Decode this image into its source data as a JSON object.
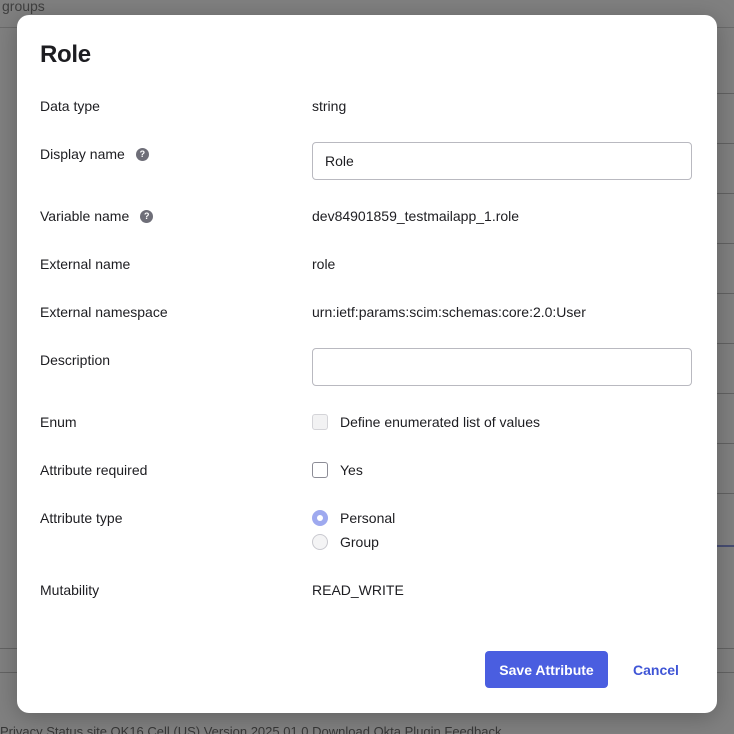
{
  "background": {
    "top_text": "groups",
    "footer_text": "Privacy   Status site   OK16 Cell (US)   Version 2025.01.0   Download Okta Plugin   Feedback"
  },
  "modal": {
    "title": "Role",
    "fields": {
      "data_type": {
        "label": "Data type",
        "value": "string"
      },
      "display_name": {
        "label": "Display name",
        "value": "Role",
        "help_icon": "question-circle-icon"
      },
      "variable_name": {
        "label": "Variable name",
        "value": "dev84901859_testmailapp_1.role",
        "help_icon": "question-circle-icon"
      },
      "external_name": {
        "label": "External name",
        "value": "role"
      },
      "external_namespace": {
        "label": "External namespace",
        "value": "urn:ietf:params:scim:schemas:core:2.0:User"
      },
      "description": {
        "label": "Description",
        "value": ""
      },
      "enum": {
        "label": "Enum",
        "option_label": "Define enumerated list of values",
        "checked": false,
        "disabled": true
      },
      "attribute_required": {
        "label": "Attribute required",
        "option_label": "Yes",
        "checked": false
      },
      "attribute_type": {
        "label": "Attribute type",
        "options": [
          {
            "label": "Personal",
            "selected": true
          },
          {
            "label": "Group",
            "selected": false
          }
        ]
      },
      "mutability": {
        "label": "Mutability",
        "value": "READ_WRITE"
      }
    },
    "buttons": {
      "save_label": "Save Attribute",
      "cancel_label": "Cancel"
    }
  },
  "colors": {
    "primary": "#4a5ee0",
    "link": "#3f55d6",
    "radio_selected": "#9ea9ef"
  }
}
